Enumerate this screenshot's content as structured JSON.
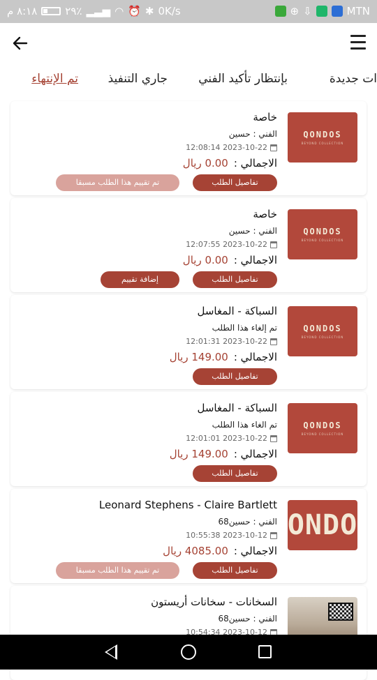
{
  "status_bar": {
    "time": "٨:١٨ م",
    "battery": "٢٩٪",
    "net_speed": "0K/s",
    "carrier": "MTN"
  },
  "colors": {
    "accent": "#a64335",
    "accent_light": "#d9a39c",
    "statusbar": "#c8c8c8"
  },
  "tabs": [
    {
      "label": "تم الإنتهاء",
      "active": true
    },
    {
      "label": "جاري التنفيذ"
    },
    {
      "label": "بإنتظار تأكيد الفني"
    },
    {
      "label": "ات جديدة"
    }
  ],
  "cards": [
    {
      "title": "خاصة",
      "tech": "الفني : حسين",
      "date": "2023-10-22 12:08:14",
      "total_label": "الاجمالي :",
      "amount": "0.00 ريال",
      "details_label": "تفاصيل الطلب",
      "extra_label": "تم تقييم هذا الطلب مسبقا",
      "thumb_text": "QONDOS",
      "thumb_sub": "BEYOND COLLECTION"
    },
    {
      "title": "خاصة",
      "tech": "الفني : حسين",
      "date": "2023-10-22 12:07:55",
      "total_label": "الاجمالي :",
      "amount": "0.00 ريال",
      "details_label": "تفاصيل الطلب",
      "extra_label": "إضافة تقييم",
      "thumb_text": "QONDOS",
      "thumb_sub": "BEYOND COLLECTION"
    },
    {
      "title": "السباكة - المغاسل",
      "tech": "تم إلغاء هذا الطلب",
      "date": "2023-10-22 12:01:31",
      "total_label": "الاجمالي :",
      "amount": "149.00 ريال",
      "details_label": "تفاصيل الطلب",
      "thumb_text": "QONDOS",
      "thumb_sub": "BEYOND COLLECTION"
    },
    {
      "title": "السباكة - المغاسل",
      "tech": "تم الغاء هذا الطلب",
      "date": "2023-10-22 12:01:01",
      "total_label": "الاجمالي :",
      "amount": "149.00 ريال",
      "details_label": "تفاصيل الطلب",
      "thumb_text": "QONDOS",
      "thumb_sub": "BEYOND COLLECTION"
    },
    {
      "title": "Leonard Stephens - Claire Bartlett",
      "tech": "الفني : حسين68",
      "date": "2023-10-12 10:55:38",
      "total_label": "الاجمالي :",
      "amount": "4085.00 ريال",
      "details_label": "تفاصيل الطلب",
      "extra_label": "تم تقييم هذا الطلب مسبقا",
      "thumb_text": "ONDO"
    },
    {
      "title": "السخانات - سخانات أريستون",
      "tech": "الفني : حسين68",
      "date": "2023-10-12 10:54:34"
    }
  ]
}
